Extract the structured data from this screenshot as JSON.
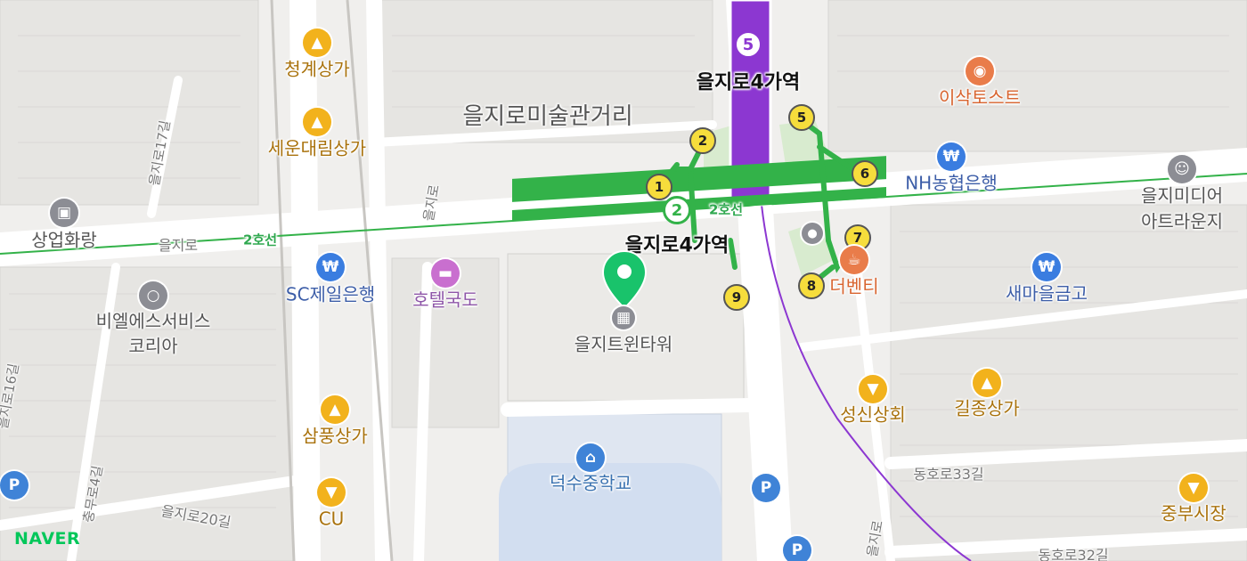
{
  "colors": {
    "line2": "#33b249",
    "line5": "#8c37d1",
    "shop": "#f2b21c",
    "bank": "#3a7de0",
    "naver": "#03c75a"
  },
  "areas": {
    "art_street": "을지로미술관거리"
  },
  "stations": {
    "top": "을지로4가역",
    "mid": "을지로4가역",
    "line5_num": "5",
    "line2_num": "2"
  },
  "lines": {
    "line2_a": "2호선",
    "line2_b": "2호선"
  },
  "exits": [
    "1",
    "2",
    "5",
    "6",
    "7",
    "8",
    "9"
  ],
  "pois": {
    "cheonggye": "청계상가",
    "seun": "세운대림상가",
    "sangup": "상업화랑",
    "sc_bank": "SC제일은행",
    "hotel": "호텔국도",
    "beeleum_1": "비엘에스서비스",
    "beeleum_2": "코리아",
    "twin": "을지트윈타워",
    "sampung": "삼풍상가",
    "cu": "CU",
    "deoksu": "덕수중학교",
    "isak": "이삭토스트",
    "nh": "NH농협은행",
    "media_1": "을지미디어",
    "media_2": "아트라운지",
    "debenti": "더벤티",
    "saemaeul": "새마을금고",
    "seongsin": "성신상회",
    "giljong": "길종상가",
    "jungbu": "중부시장"
  },
  "roads": {
    "euljiro": "을지로",
    "euljiro17": "을지로17길",
    "euljiro_v": "을지로",
    "euljiro16": "을지로16길",
    "chungmuro4": "충무로4길",
    "euljiro20": "을지로20길",
    "donghoro33": "동호로33길",
    "donghoro32": "동호로32길",
    "right_v": "을지로"
  },
  "icons": {
    "shop": "shopping-bag-icon",
    "bank": "won-icon",
    "cafe": "coffee-icon",
    "hotel": "bed-icon",
    "gallery": "picture-icon",
    "building": "building-icon",
    "school": "school-icon",
    "parking": "parking-icon",
    "pin": "location-pin-icon",
    "toilet": "toilet-icon",
    "convenience": "basket-icon"
  },
  "parking_label": "P",
  "brand": "NAVER"
}
